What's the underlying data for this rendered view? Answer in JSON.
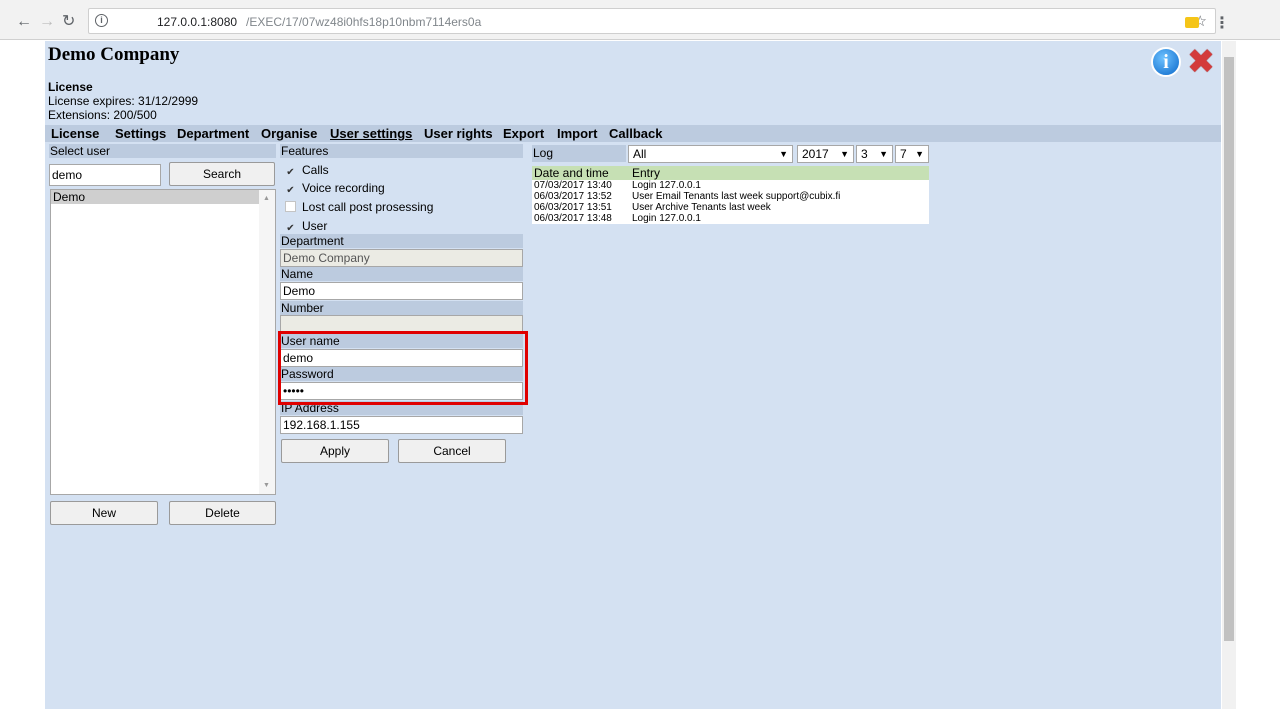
{
  "browser": {
    "url_host": "127.0.0.1:8080",
    "url_path": "/EXEC/17/07wz48i0hfs18p10nbm7114ers0a"
  },
  "header": {
    "company": "Demo Company",
    "license_title": "License",
    "license_expires": "License expires: 31/12/2999",
    "extensions": "Extensions: 200/500"
  },
  "menu": {
    "items": [
      "License",
      "Settings",
      "Department",
      "Organise",
      "User settings",
      "User rights",
      "Export",
      "Import",
      "Callback"
    ],
    "active": "User settings"
  },
  "user_panel": {
    "header": "Select user",
    "search_value": "demo",
    "search_button": "Search",
    "users": [
      "Demo"
    ],
    "new_button": "New",
    "delete_button": "Delete"
  },
  "details": {
    "features_header": "Features",
    "features": [
      {
        "label": "Calls",
        "checked": true
      },
      {
        "label": "Voice recording",
        "checked": true
      },
      {
        "label": "Lost call post prosessing",
        "checked": false
      },
      {
        "label": "User",
        "checked": true
      }
    ],
    "department_label": "Department",
    "department_value": "Demo Company",
    "name_label": "Name",
    "name_value": "Demo",
    "number_label": "Number",
    "number_value": "",
    "username_label": "User name",
    "username_value": "demo",
    "password_label": "Password",
    "password_value": "•••••",
    "ip_label": "IP Address",
    "ip_value": "192.168.1.155",
    "apply_button": "Apply",
    "cancel_button": "Cancel"
  },
  "log": {
    "label": "Log",
    "filter": "All",
    "year": "2017",
    "month": "3",
    "day": "7",
    "columns": [
      "Date and time",
      "Entry"
    ],
    "rows": [
      [
        "07/03/2017 13:40",
        "Login 127.0.0.1"
      ],
      [
        "06/03/2017 13:52",
        "User Email Tenants last week support@cubix.fi"
      ],
      [
        "06/03/2017 13:51",
        "User Archive Tenants last week"
      ],
      [
        "06/03/2017 13:48",
        "Login 127.0.0.1"
      ]
    ]
  },
  "colors": {
    "page_bg": "#d4e1f2",
    "header_bg": "#bccbdf",
    "log_header_bg": "#c6e0b4",
    "highlight": "#e00000"
  }
}
